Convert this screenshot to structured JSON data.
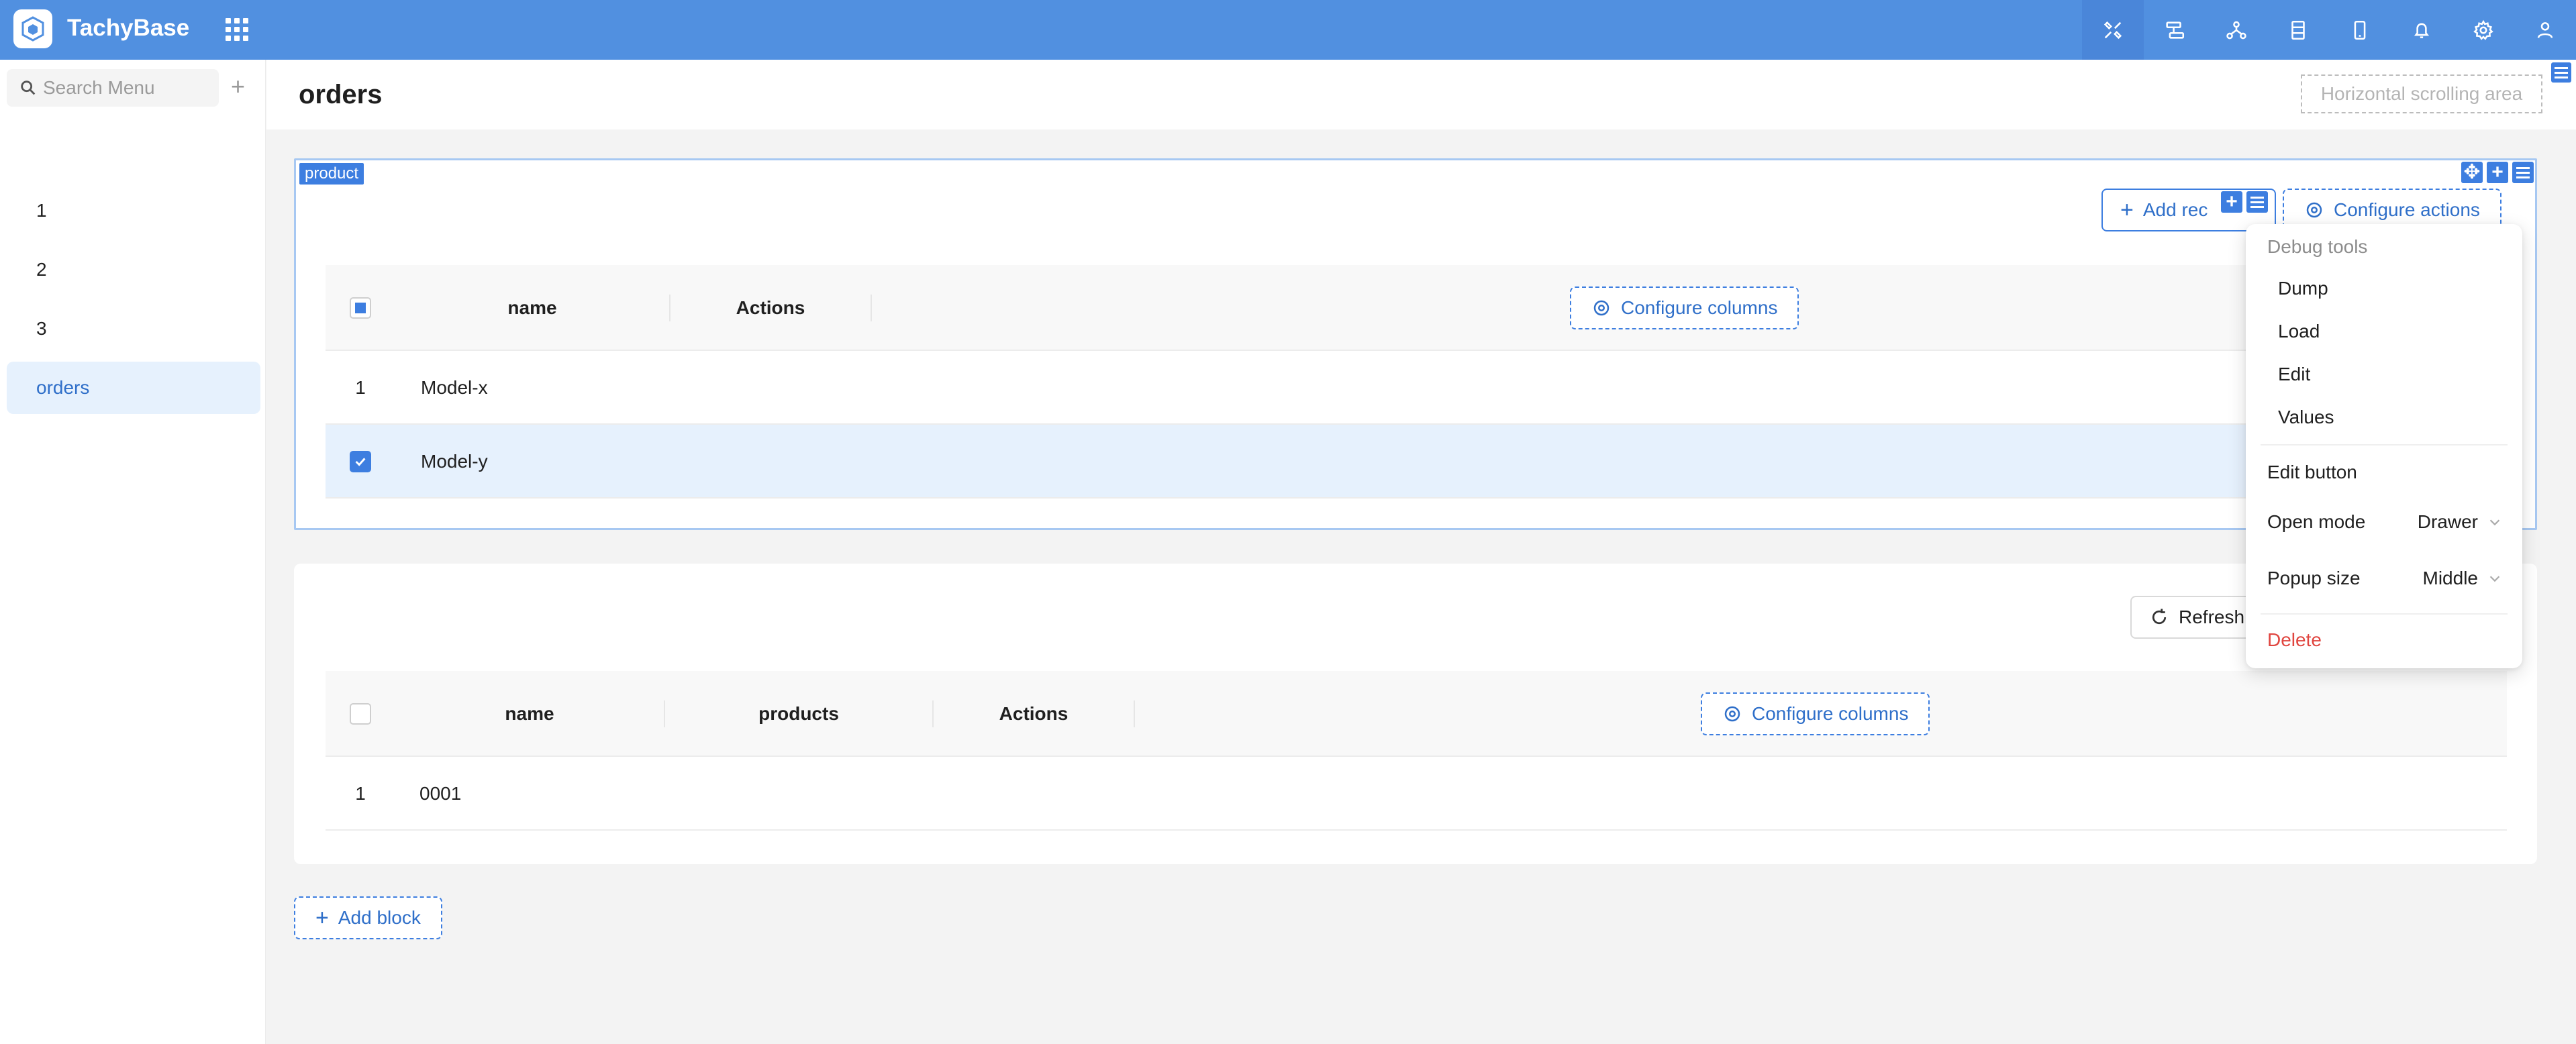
{
  "app": {
    "title": "TachyBase"
  },
  "sidebar": {
    "search_placeholder": "Search Menu",
    "items": [
      {
        "label": "1"
      },
      {
        "label": "2"
      },
      {
        "label": "3"
      },
      {
        "label": "orders"
      }
    ]
  },
  "page": {
    "title": "orders",
    "hscroll_label": "Horizontal scrolling area"
  },
  "block1": {
    "tag": "product",
    "add_record_label": "Add rec",
    "configure_actions_label": "Configure actions",
    "configure_columns_label": "Configure columns",
    "columns": [
      "name",
      "Actions"
    ],
    "rows": [
      {
        "index": "1",
        "name": "Model-x"
      },
      {
        "index": "",
        "name": "Model-y"
      }
    ]
  },
  "block2": {
    "refresh_label": "Refresh",
    "configure_columns_label": "Configure columns",
    "columns": [
      "name",
      "products",
      "Actions"
    ],
    "rows": [
      {
        "index": "1",
        "name": "0001"
      }
    ]
  },
  "add_block_label": "Add block",
  "dropdown": {
    "group_label": "Debug tools",
    "debug_items": [
      "Dump",
      "Load",
      "Edit",
      "Values"
    ],
    "edit_button_label": "Edit button",
    "open_mode_label": "Open mode",
    "open_mode_value": "Drawer",
    "popup_size_label": "Popup size",
    "popup_size_value": "Middle",
    "delete_label": "Delete"
  },
  "colors": {
    "header_bg": "#5190e0",
    "accent": "#3d7ee0",
    "selected_bg": "#e6f1fd",
    "danger": "#e0453f"
  }
}
